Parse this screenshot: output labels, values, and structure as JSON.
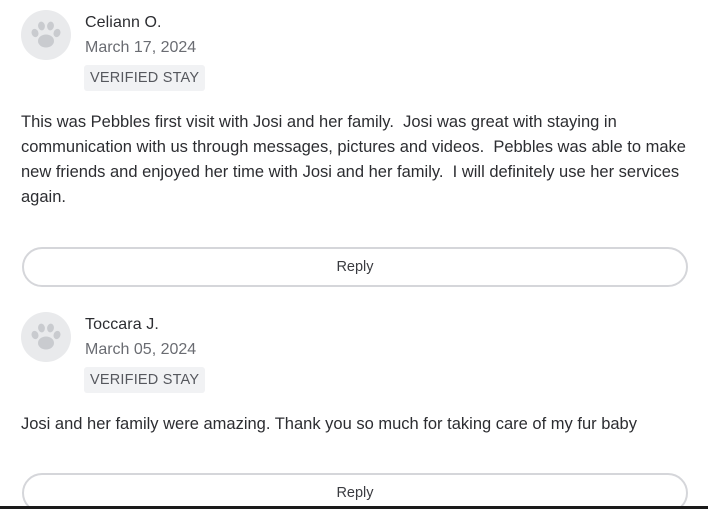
{
  "reviews": [
    {
      "reviewer_name": "Celiann O.",
      "date": "March 17, 2024",
      "badge": "VERIFIED STAY",
      "text": "This was Pebbles first visit with Josi and her family.  Josi was great with staying in communication with us through messages, pictures and videos.  Pebbles was able to make new friends and enjoyed her time with Josi and her family.  I will definitely use her services again.",
      "reply_label": "Reply",
      "avatar_icon": "paw-icon"
    },
    {
      "reviewer_name": "Toccara J.",
      "date": "March 05, 2024",
      "badge": "VERIFIED STAY",
      "text": "Josi and her family were amazing. Thank you so much for taking care of my fur baby",
      "reply_label": "Reply",
      "avatar_icon": "paw-icon"
    }
  ],
  "colors": {
    "avatar_bg": "#e9eaec",
    "paw": "#c9cbcf",
    "badge_bg": "#f1f2f4",
    "button_border": "#d5d6da",
    "text": "#2c2d31",
    "muted": "#6a6c72"
  }
}
